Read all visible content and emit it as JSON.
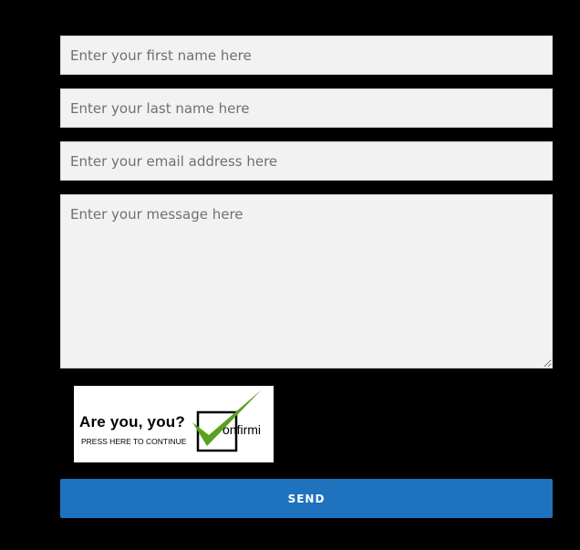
{
  "form": {
    "first_name": {
      "value": "",
      "placeholder": "Enter your first name here"
    },
    "last_name": {
      "value": "",
      "placeholder": "Enter your last name here"
    },
    "email": {
      "value": "",
      "placeholder": "Enter your email address here"
    },
    "message": {
      "value": "",
      "placeholder": "Enter your message here"
    },
    "send_label": "SEND"
  },
  "captcha": {
    "title": "Are you, you?",
    "subtitle": "PRESS HERE TO CONTINUE",
    "brand": "onfirmi",
    "logo_icon": "checkmark-box-icon",
    "check_color": "#5aa01e"
  },
  "colors": {
    "page_background": "#000000",
    "field_background": "#f2f2f2",
    "button_background": "#1f72be",
    "button_text": "#ffffff"
  }
}
